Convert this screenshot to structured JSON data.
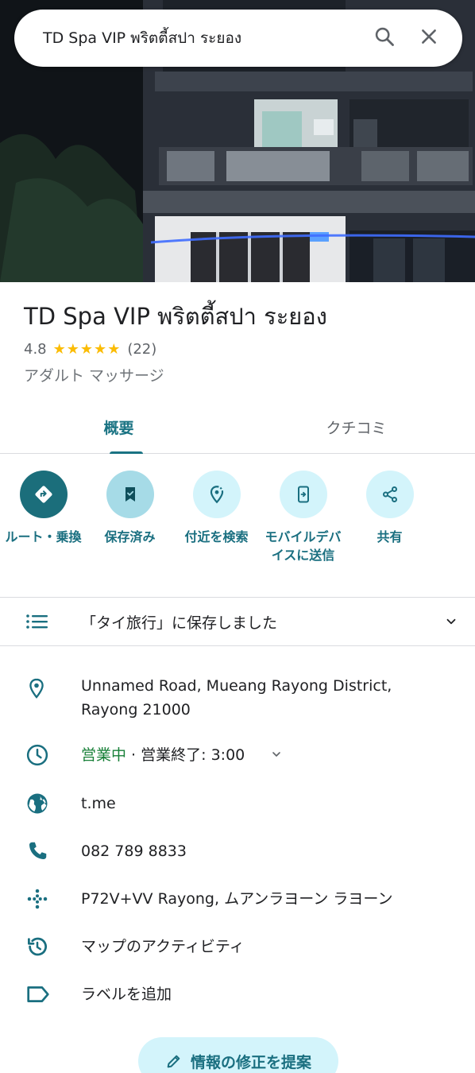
{
  "search": {
    "query": "TD Spa VIP พริตตี้สปา ระยอง"
  },
  "place": {
    "title": "TD Spa VIP พริตตี้สปา ระยอง",
    "rating": "4.8",
    "stars": "★★★★★",
    "review_count": "(22)",
    "category": "アダルト マッサージ"
  },
  "tabs": [
    {
      "label": "概要",
      "active": true
    },
    {
      "label": "クチコミ",
      "active": false
    }
  ],
  "actions": [
    {
      "label": "ルート・乗換",
      "icon": "directions-icon"
    },
    {
      "label": "保存済み",
      "icon": "bookmark-icon"
    },
    {
      "label": "付近を検索",
      "icon": "nearby-icon"
    },
    {
      "label": "モバイルデバイスに送信",
      "icon": "send-to-phone-icon"
    },
    {
      "label": "共有",
      "icon": "share-icon"
    }
  ],
  "saved_list": {
    "text": "「タイ旅行」に保存しました"
  },
  "info": {
    "address": "Unnamed Road, Mueang Rayong District, Rayong 21000",
    "hours_status": "営業中",
    "hours_detail": " · 営業終了: 3:00",
    "website": "t.me",
    "phone": "082 789 8833",
    "plus_code": "P72V+VV Rayong, ムアンラヨーン ラヨーン",
    "activity": "マップのアクティビティ",
    "label": "ラベルを追加"
  },
  "suggest_edit": {
    "label": "情報の修正を提案"
  },
  "colors": {
    "accent": "#1a7383",
    "open": "#188038",
    "star": "#fbbc04",
    "chip": "#d3f4fb"
  }
}
